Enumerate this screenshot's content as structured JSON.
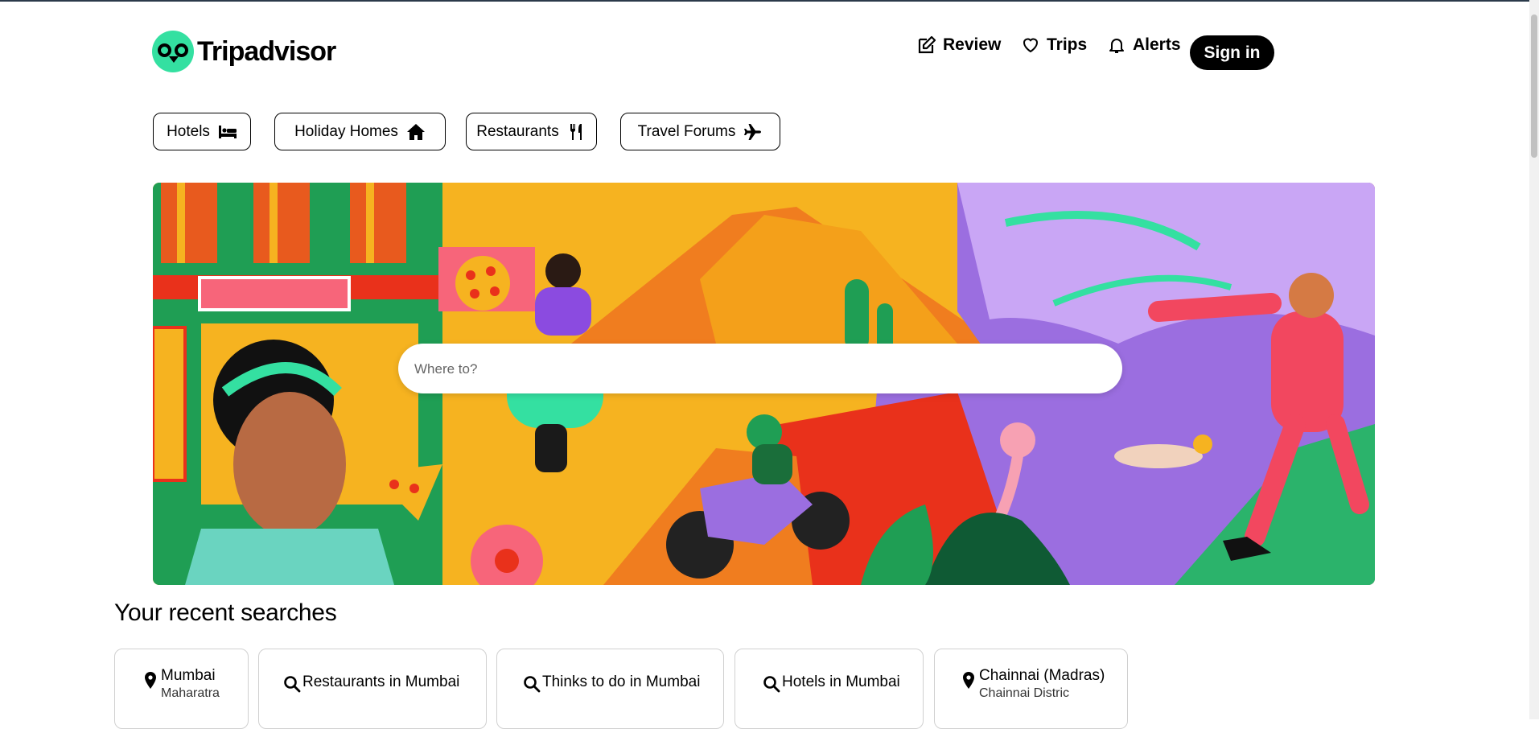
{
  "brand": {
    "name": "Tripadvisor"
  },
  "nav": {
    "review_label": "Review",
    "trips_label": "Trips",
    "alerts_label": "Alerts",
    "signin_label": "Sign in"
  },
  "categories": [
    {
      "label": "Hotels",
      "icon": "bed-icon"
    },
    {
      "label": "Holiday Homes",
      "icon": "home-icon"
    },
    {
      "label": "Restaurants",
      "icon": "cutlery-icon"
    },
    {
      "label": "Travel Forums",
      "icon": "plane-icon"
    }
  ],
  "search": {
    "placeholder": "Where to?"
  },
  "recent": {
    "title": "Your recent searches",
    "items": [
      {
        "icon": "map-pin-icon",
        "title": "Mumbai",
        "subtitle": "Maharatra"
      },
      {
        "icon": "search-icon",
        "title": "Restaurants in Mumbai"
      },
      {
        "icon": "search-icon",
        "title": "Thinks to do in Mumbai"
      },
      {
        "icon": "search-icon",
        "title": "Hotels in Mumbai"
      },
      {
        "icon": "map-pin-icon",
        "title": "Chainnai (Madras)",
        "subtitle": "Chainnai Distric"
      }
    ]
  },
  "colors": {
    "brand_green": "#34e0a1",
    "black": "#000000",
    "hero_orange": "#f6b320",
    "hero_purple": "#9b6ee0"
  }
}
